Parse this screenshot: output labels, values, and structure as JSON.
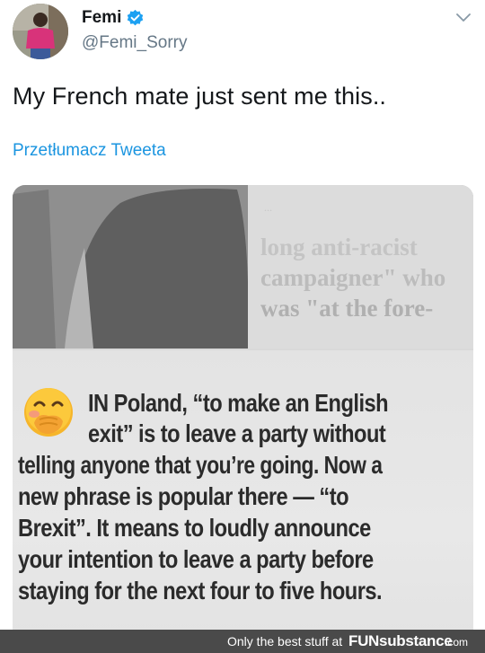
{
  "user": {
    "display_name": "Femi",
    "handle": "@Femi_Sorry"
  },
  "tweet": {
    "text": "My French mate just sent me this..",
    "translate_link": "Przetłumacz Tweeta"
  },
  "media": {
    "clipping_upper_lines": [
      "long anti-racist",
      "campaigner\" who",
      "was \"at the fore-"
    ],
    "clipping_emoji": "face-with-hand-over-mouth-icon",
    "clipping_lines": [
      "IN Poland, “to make an English",
      "exit” is to leave a party without",
      "telling anyone that you’re going. Now a",
      "new phrase is popular there — “to",
      "Brexit”. It means to loudly announce",
      "your intention to leave a party before",
      "staying for the next four to five hours."
    ]
  },
  "watermark": {
    "text": "Only the best stuff at",
    "brand": "FUNsubstance",
    "domain": ".com"
  },
  "colors": {
    "link": "#1b95e0",
    "handle": "#657786",
    "verified": "#1da1f2",
    "footer_bg": "#4a4a4a"
  }
}
